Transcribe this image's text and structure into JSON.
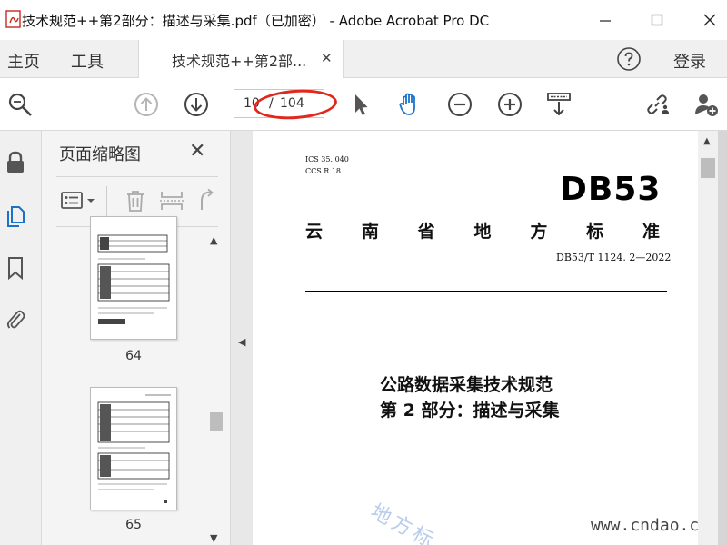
{
  "window": {
    "title": "技术规范++第2部分：描述与采集.pdf（已加密） - Adobe Acrobat Pro DC"
  },
  "menubar": {
    "home": "主页",
    "tools": "工具",
    "doc_tab": "技术规范++第2部...",
    "login": "登录"
  },
  "toolbar": {
    "page_current": "10",
    "page_separator": "/",
    "page_total": "104"
  },
  "thumbnails": {
    "title": "页面缩略图",
    "pages": [
      {
        "label": "64"
      },
      {
        "label": "65"
      }
    ]
  },
  "document": {
    "ics": "ICS 35. 040",
    "ccs": "CCS R 18",
    "logo": "DB53",
    "region_chars": [
      "云",
      "南",
      "省",
      "地",
      "方",
      "标",
      "准"
    ],
    "standard_no": "DB53/T 1124. 2—2022",
    "title_line1": "公路数据采集技术规范",
    "title_line2": "第 2 部分：描述与采集",
    "watermark_text": "地方标",
    "site_watermark": "www.cndao.com"
  },
  "colors": {
    "accent_blue": "#1a73c8",
    "annotation_red": "#e0281e",
    "frame_yellow": "#f5d800"
  }
}
